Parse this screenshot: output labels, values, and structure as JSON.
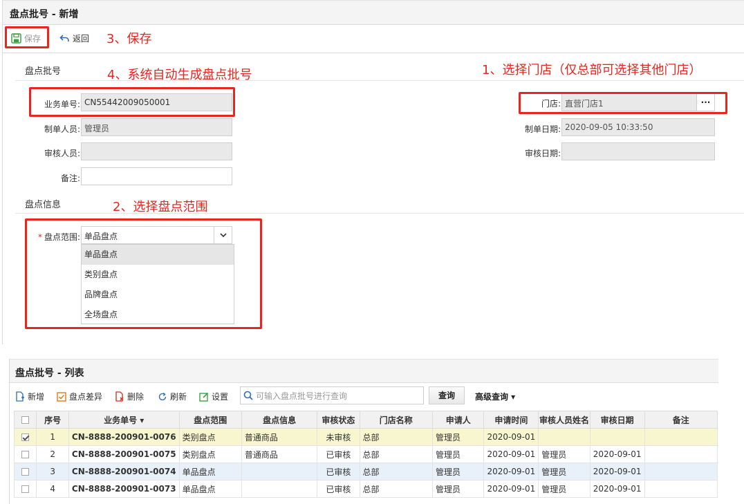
{
  "form": {
    "title": "盘点批号 - 新增",
    "toolbar": {
      "save_label": "保存",
      "back_label": "返回"
    },
    "section_batch": "盘点批号",
    "section_info": "盘点信息",
    "fields": {
      "doc_no_label": "业务单号:",
      "doc_no_value": "CN55442009050001",
      "creator_label": "制单人员:",
      "creator_value": "管理员",
      "reviewer_label": "审核人员:",
      "reviewer_value": "",
      "remark_label": "备注:",
      "remark_value": "",
      "store_label": "门店:",
      "store_value": "直营门店1",
      "store_btn": "···",
      "created_date_label": "制单日期:",
      "created_date_value": "2020-09-05 10:33:50",
      "review_date_label": "审核日期:",
      "review_date_value": "",
      "scope_required": "*",
      "scope_label": "盘点范围:",
      "scope_value": "单品盘点"
    },
    "scope_options": [
      "单品盘点",
      "类别盘点",
      "品牌盘点",
      "全场盘点"
    ],
    "scope_selected_index": 0
  },
  "annotations": {
    "save": "3、保存",
    "auto_number": "4、系统自动生成盘点批号",
    "select_store": "1、选择门店（仅总部可选择其他门店）",
    "select_scope": "2、选择盘点范围",
    "color": "#e8251e"
  },
  "list": {
    "title": "盘点批号 - 列表",
    "toolbar": {
      "add": "新增",
      "diff": "盘点差异",
      "delete": "删除",
      "refresh": "刷新",
      "settings": "设置",
      "search_placeholder": "可输入盘点批号进行查询",
      "query": "查询",
      "advanced": "高级查询 ▾"
    },
    "columns": [
      "序号",
      "业务单号 ▾",
      "盘点范围",
      "盘点信息",
      "审核状态",
      "门店名称",
      "申请人",
      "申请时间",
      "审核人员姓名",
      "审核日期",
      "备注"
    ],
    "rows": [
      {
        "checked": true,
        "no": "1",
        "doc": "CN-8888-200901-0076",
        "scope": "类别盘点",
        "info": "普通商品",
        "status": "未审核",
        "store": "总部",
        "applicant": "管理员",
        "apply_date": "2020-09-01",
        "reviewer": "",
        "review_date": "",
        "remark": ""
      },
      {
        "checked": false,
        "no": "2",
        "doc": "CN-8888-200901-0075",
        "scope": "类别盘点",
        "info": "普通商品",
        "status": "已审核",
        "store": "总部",
        "applicant": "管理员",
        "apply_date": "2020-09-01",
        "reviewer": "管理员",
        "review_date": "2020-09-01",
        "remark": ""
      },
      {
        "checked": false,
        "no": "3",
        "doc": "CN-8888-200901-0074",
        "scope": "单品盘点",
        "info": "",
        "status": "已审核",
        "store": "总部",
        "applicant": "管理员",
        "apply_date": "2020-09-01",
        "reviewer": "管理员",
        "review_date": "2020-09-01",
        "remark": ""
      },
      {
        "checked": false,
        "no": "4",
        "doc": "CN-8888-200901-0073",
        "scope": "单品盘点",
        "info": "",
        "status": "已审核",
        "store": "总部",
        "applicant": "管理员",
        "apply_date": "2020-09-01",
        "reviewer": "管理员",
        "review_date": "2020-09-01",
        "remark": ""
      }
    ]
  }
}
